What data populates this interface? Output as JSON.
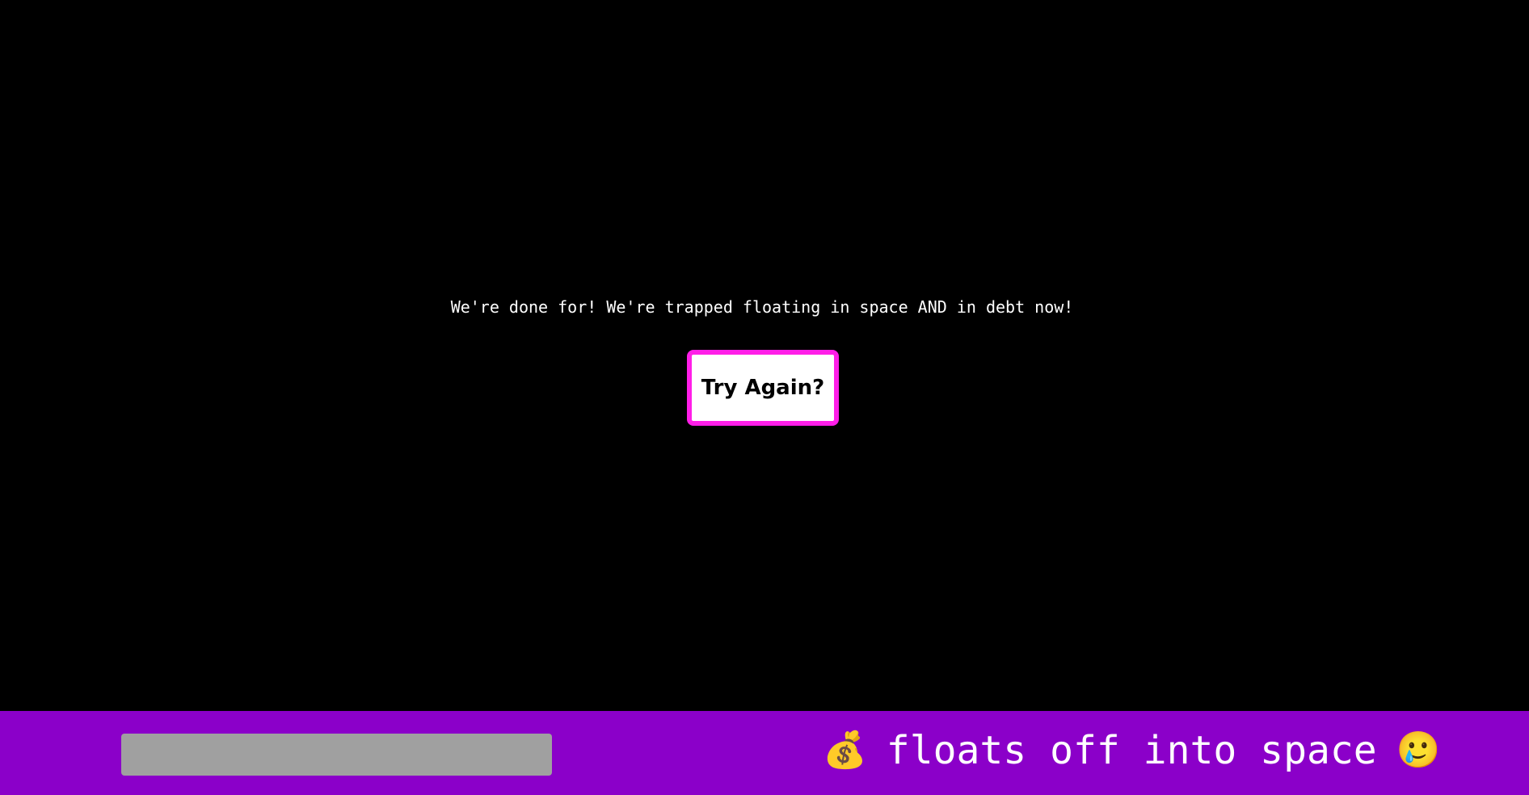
{
  "game": {
    "message": "We're done for! We're trapped floating in space AND in debt now!",
    "try_again_label": "Try Again?"
  },
  "status_bar": {
    "progress": 0,
    "money_emoji": "💰",
    "text": "floats off into space",
    "sad_emoji": "🥲"
  },
  "colors": {
    "background": "#000000",
    "button_border": "#ff1ee8",
    "bar_background": "#8b00c9",
    "progress_track": "#a0a0a0"
  },
  "icons": {
    "money": "money-bag-icon",
    "sad": "smiling-face-with-tear-icon"
  }
}
